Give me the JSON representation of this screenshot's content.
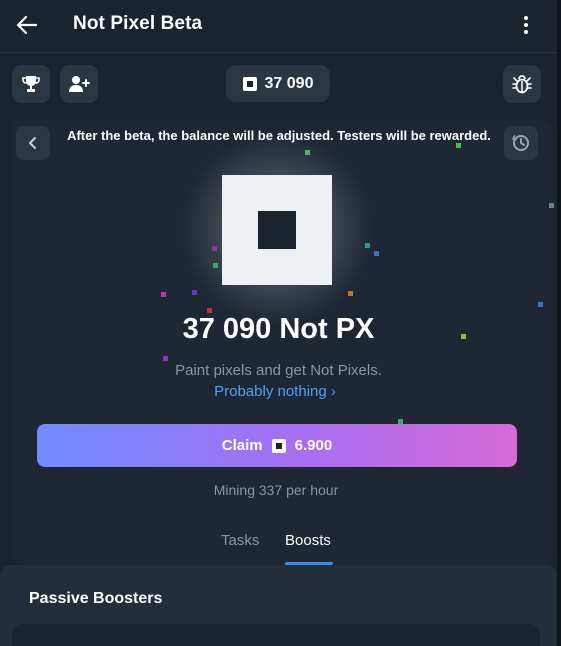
{
  "header": {
    "title": "Not Pixel Beta"
  },
  "toolbar": {
    "balance": "37 090"
  },
  "notice": {
    "text": "After the beta, the balance will be adjusted. Testers will be rewarded."
  },
  "main": {
    "amount": "37 090 Not PX",
    "subtitle": "Paint pixels and get Not Pixels.",
    "link": "Probably nothing ›",
    "claim_label": "Claim",
    "claim_value": "6.900",
    "mining": "Mining 337 per hour"
  },
  "tabs": [
    {
      "label": "Tasks",
      "active": false
    },
    {
      "label": "Boosts",
      "active": true
    }
  ],
  "boosters": {
    "title": "Passive Boosters"
  },
  "colors": {
    "background": "#1b232e",
    "accent_link": "#4aa3ff",
    "claim_gradient_start": "#6f8dff",
    "claim_gradient_end": "#d66ad8",
    "tab_underline": "#3b8fea"
  },
  "icons": {
    "back": "arrow-left-icon",
    "menu": "kebab-icon",
    "leaderboard": "trophy-icon",
    "invite": "add-user-icon",
    "pixel": "pixel-square-icon",
    "debug": "bug-icon",
    "prev": "chevron-left-icon",
    "history": "history-icon"
  }
}
